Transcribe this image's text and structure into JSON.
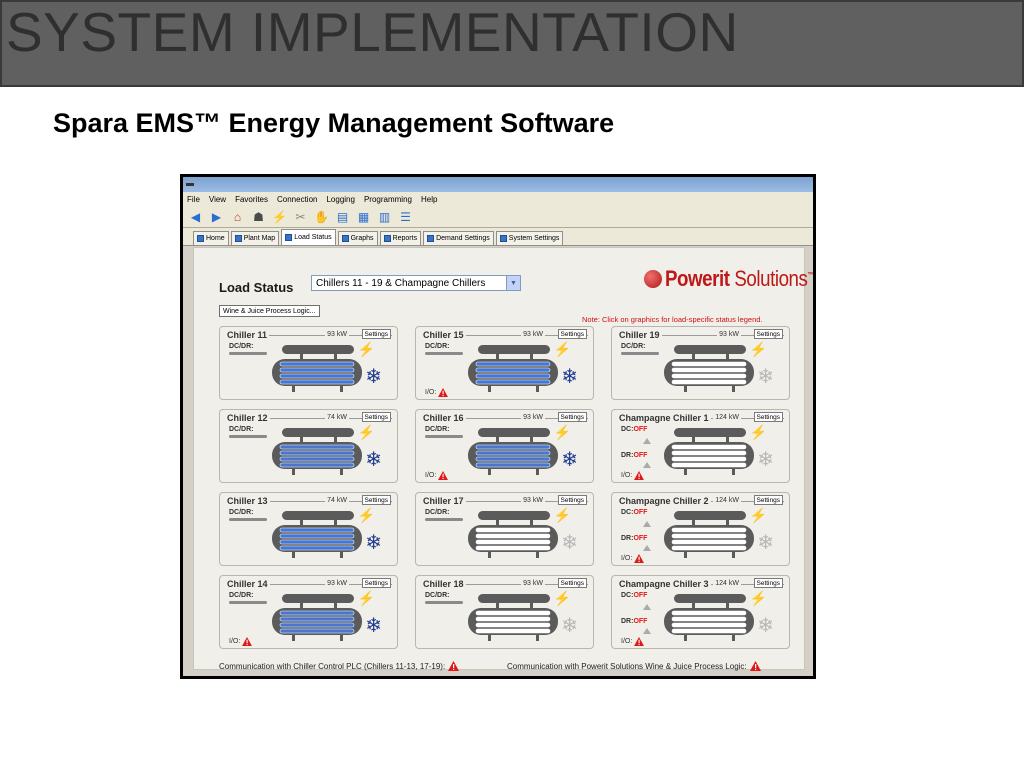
{
  "slide": {
    "title": "SYSTEM IMPLEMENTATION",
    "subtitle": "Spara EMS™ Energy Management Software"
  },
  "menu": [
    "File",
    "View",
    "Favorites",
    "Connection",
    "Logging",
    "Programming",
    "Help"
  ],
  "toolbar_icons": [
    "back-icon",
    "forward-icon",
    "home-icon",
    "person-icon",
    "plug-icon",
    "disconnect-icon",
    "handshake-icon",
    "database-icon",
    "grid-icon",
    "calendar-icon",
    "list-icon"
  ],
  "tabs": [
    {
      "label": "Home"
    },
    {
      "label": "Plant Map"
    },
    {
      "label": "Load Status",
      "active": true
    },
    {
      "label": "Graphs"
    },
    {
      "label": "Reports"
    },
    {
      "label": "Demand Settings"
    },
    {
      "label": "System Settings"
    }
  ],
  "load_status": {
    "title": "Load Status",
    "selected_group": "Chillers 11 - 19 & Champagne Chillers",
    "wine_juice_button": "Wine & Juice Process Logic...",
    "note": "Note: Click on graphics for load-specific status legend.",
    "logo_brand": "Powerit",
    "logo_suffix": "Solutions",
    "logo_tm": "™"
  },
  "common": {
    "settings_label": "Settings",
    "dc_dr_label": "DC/DR:",
    "dc_label": "DC:",
    "dr_label": "DR:",
    "off_label": "OFF",
    "io_label": "I/O:"
  },
  "chillers": [
    {
      "name": "Chiller 11",
      "kw": "93 kW",
      "type": "dcdr",
      "active": true,
      "io_alert": false
    },
    {
      "name": "Chiller 15",
      "kw": "93 kW",
      "type": "dcdr",
      "active": true,
      "io_alert": true
    },
    {
      "name": "Chiller 19",
      "kw": "93 kW",
      "type": "dcdr",
      "active": false,
      "io_alert": false
    },
    {
      "name": "Chiller 12",
      "kw": "74 kW",
      "type": "dcdr",
      "active": true,
      "io_alert": false
    },
    {
      "name": "Chiller 16",
      "kw": "93 kW",
      "type": "dcdr",
      "active": true,
      "io_alert": true
    },
    {
      "name": "Champagne Chiller 1",
      "kw": "124 kW",
      "type": "champagne",
      "active": false,
      "io_alert": true
    },
    {
      "name": "Chiller 13",
      "kw": "74 kW",
      "type": "dcdr",
      "active": true,
      "io_alert": false
    },
    {
      "name": "Chiller 17",
      "kw": "93 kW",
      "type": "dcdr",
      "active": false,
      "io_alert": false
    },
    {
      "name": "Champagne Chiller 2",
      "kw": "124 kW",
      "type": "champagne",
      "active": false,
      "io_alert": true
    },
    {
      "name": "Chiller 14",
      "kw": "93 kW",
      "type": "dcdr",
      "active": true,
      "io_alert": true
    },
    {
      "name": "Chiller 18",
      "kw": "93 kW",
      "type": "dcdr",
      "active": false,
      "io_alert": false
    },
    {
      "name": "Champagne Chiller 3",
      "kw": "124 kW",
      "type": "champagne",
      "active": false,
      "io_alert": true
    }
  ],
  "status_bar": {
    "plc_comm": "Communication with Chiller Control PLC (Chillers 11-13, 17-19):",
    "wj_comm": "Communication with Powerit Solutions Wine & Juice Process Logic:"
  },
  "colors": {
    "alert": "#e01818",
    "active_coil": "#3b7be0",
    "inactive_coil": "#ffffff",
    "snowflake_on": "#213a8f"
  }
}
